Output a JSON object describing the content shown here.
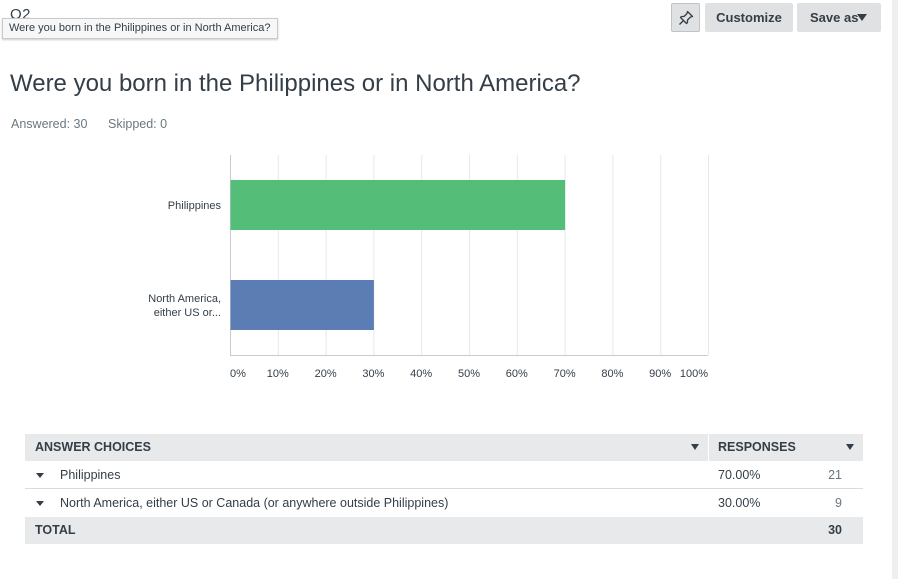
{
  "question": {
    "number": "Q2",
    "tooltip": "Were you born in the Philippines or in North America?",
    "title": "Were you born in the Philippines or in North America?",
    "answered": "Answered: 30",
    "skipped": "Skipped: 0"
  },
  "toolbar": {
    "pin_icon": "pin-icon",
    "customize_label": "Customize",
    "saveas_label": "Save as"
  },
  "chart_data": {
    "type": "bar",
    "orientation": "horizontal",
    "categories": [
      "Philippines",
      "North America, either US or..."
    ],
    "category_lines": [
      [
        "Philippines"
      ],
      [
        "North America,",
        "either US or..."
      ]
    ],
    "values": [
      70,
      30
    ],
    "colors": [
      "#54bd78",
      "#5b7db4"
    ],
    "xlim": [
      0,
      100
    ],
    "xticks": [
      "0%",
      "10%",
      "20%",
      "30%",
      "40%",
      "50%",
      "60%",
      "70%",
      "80%",
      "90%",
      "100%"
    ],
    "grid": true
  },
  "table": {
    "headers": {
      "answer": "ANSWER CHOICES",
      "responses": "RESPONSES"
    },
    "rows": [
      {
        "choice": "Philippines",
        "percent": "70.00%",
        "count": "21"
      },
      {
        "choice": "North America, either US or Canada (or anywhere outside Philippines)",
        "percent": "30.00%",
        "count": "9"
      }
    ],
    "total_label": "TOTAL",
    "total_count": "30"
  }
}
